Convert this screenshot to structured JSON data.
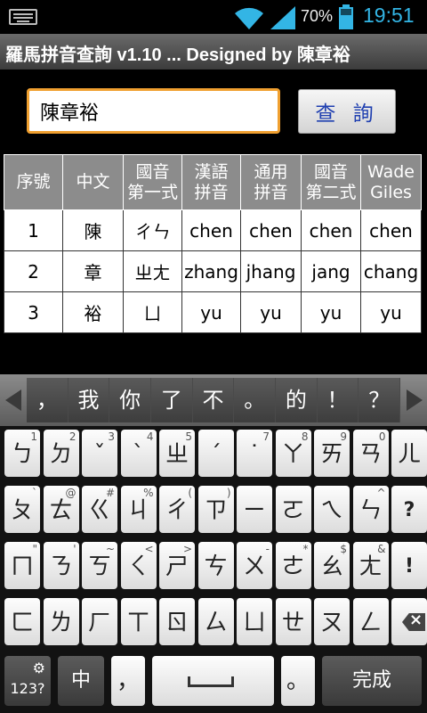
{
  "status_bar": {
    "battery_text": "70%",
    "time": "19:51",
    "time_color": "#33b5e5"
  },
  "title": "羅馬拼音查詢 v1.10    ... Designed by 陳章裕",
  "search": {
    "input_value": "陳章裕",
    "button_label": "查 詢"
  },
  "table": {
    "headers": [
      [
        "序號",
        ""
      ],
      [
        "中文",
        ""
      ],
      [
        "國音",
        "第一式"
      ],
      [
        "漢語",
        "拼音"
      ],
      [
        "通用",
        "拼音"
      ],
      [
        "國音",
        "第二式"
      ],
      [
        "Wade",
        "Giles"
      ]
    ],
    "rows": [
      [
        "1",
        "陳",
        "ㄔㄣ",
        "chen",
        "chen",
        "chen",
        "chen"
      ],
      [
        "2",
        "章",
        "ㄓㄤ",
        "zhang",
        "jhang",
        "jang",
        "chang"
      ],
      [
        "3",
        "裕",
        "ㄩ",
        "yu",
        "yu",
        "yu",
        "yu"
      ]
    ]
  },
  "candidates": [
    "，",
    "我",
    "你",
    "了",
    "不",
    "。",
    "的",
    "！",
    "？"
  ],
  "keyboard": {
    "row1": [
      {
        "m": "ㄅ",
        "s": "1"
      },
      {
        "m": "ㄉ",
        "s": "2"
      },
      {
        "m": "ˇ",
        "s": "3"
      },
      {
        "m": "ˋ",
        "s": "4"
      },
      {
        "m": "ㄓ",
        "s": "5"
      },
      {
        "m": "ˊ",
        "s": ""
      },
      {
        "m": "˙",
        "s": "7"
      },
      {
        "m": "ㄚ",
        "s": "8"
      },
      {
        "m": "ㄞ",
        "s": "9"
      },
      {
        "m": "ㄢ",
        "s": "0"
      },
      {
        "m": "ㄦ",
        "s": ""
      }
    ],
    "row2": [
      {
        "m": "ㄆ",
        "s": "`"
      },
      {
        "m": "ㄊ",
        "s": "@"
      },
      {
        "m": "ㄍ",
        "s": "#"
      },
      {
        "m": "ㄐ",
        "s": "%"
      },
      {
        "m": "ㄔ",
        "s": "("
      },
      {
        "m": "ㄗ",
        "s": ")"
      },
      {
        "m": "ㄧ",
        "s": ""
      },
      {
        "m": "ㄛ",
        "s": ""
      },
      {
        "m": "ㄟ",
        "s": ""
      },
      {
        "m": "ㄣ",
        "s": "^"
      },
      {
        "m": "?",
        "s": ""
      }
    ],
    "row3": [
      {
        "m": "ㄇ",
        "s": "\""
      },
      {
        "m": "ㄋ",
        "s": "'"
      },
      {
        "m": "ㄎ",
        "s": "~"
      },
      {
        "m": "ㄑ",
        "s": "<"
      },
      {
        "m": "ㄕ",
        "s": ">"
      },
      {
        "m": "ㄘ",
        "s": ""
      },
      {
        "m": "ㄨ",
        "s": "-"
      },
      {
        "m": "ㄜ",
        "s": "*"
      },
      {
        "m": "ㄠ",
        "s": "$"
      },
      {
        "m": "ㄤ",
        "s": "&"
      },
      {
        "m": "!",
        "s": ""
      }
    ],
    "row4": [
      {
        "m": "ㄈ",
        "s": ""
      },
      {
        "m": "ㄌ",
        "s": ""
      },
      {
        "m": "ㄏ",
        "s": ""
      },
      {
        "m": "ㄒ",
        "s": ""
      },
      {
        "m": "ㄖ",
        "s": ""
      },
      {
        "m": "ㄙ",
        "s": ""
      },
      {
        "m": "ㄩ",
        "s": ""
      },
      {
        "m": "ㄝ",
        "s": ""
      },
      {
        "m": "ㄡ",
        "s": ""
      },
      {
        "m": "ㄥ",
        "s": ""
      }
    ],
    "bottom": {
      "symbols_label": "123?",
      "lang_label": "中",
      "comma_label": "，",
      "period_label": "。",
      "done_label": "完成"
    }
  }
}
